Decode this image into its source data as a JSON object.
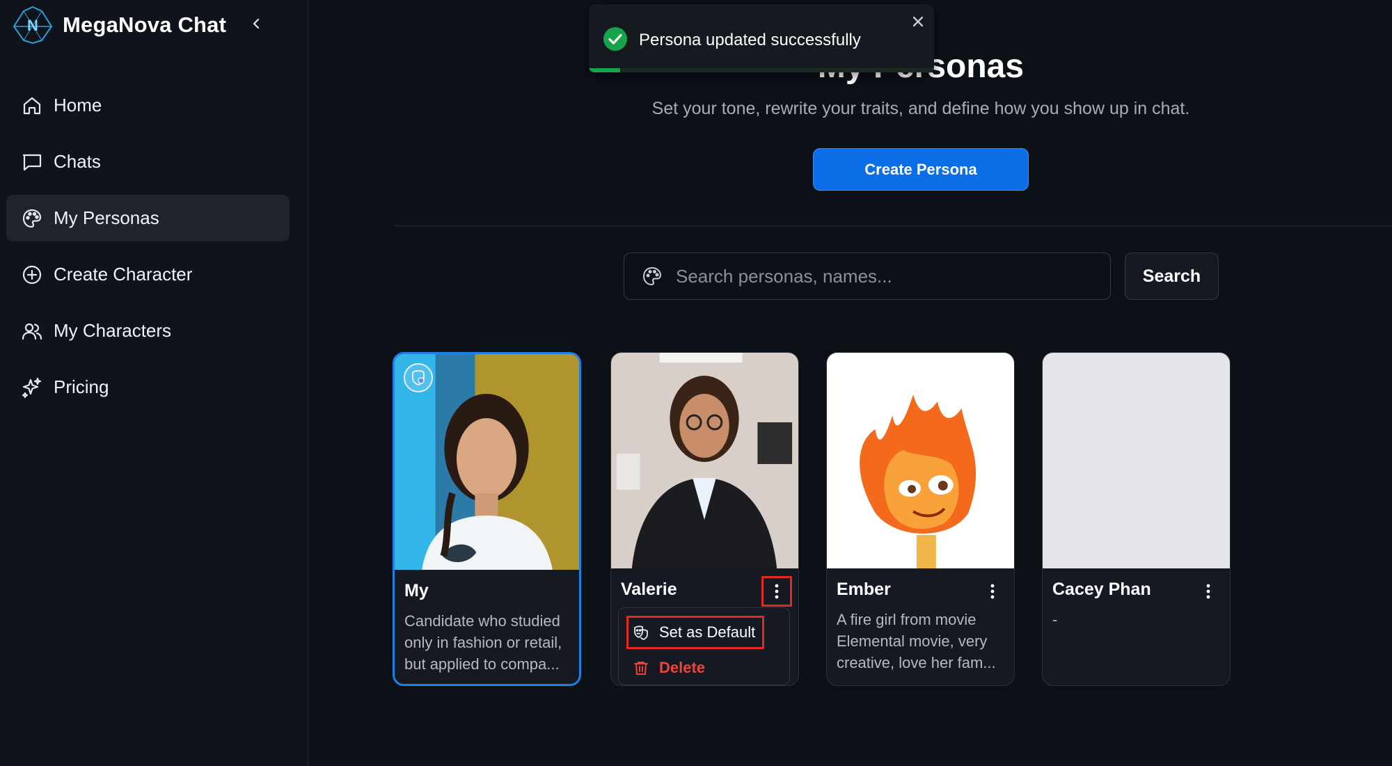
{
  "app": {
    "name": "MegaNova Chat"
  },
  "sidebar": {
    "items": [
      {
        "label": "Home",
        "icon": "home-icon"
      },
      {
        "label": "Chats",
        "icon": "chat-icon"
      },
      {
        "label": "My Personas",
        "icon": "palette-icon",
        "active": true
      },
      {
        "label": "Create Character",
        "icon": "plus-circle-icon"
      },
      {
        "label": "My Characters",
        "icon": "users-icon"
      },
      {
        "label": "Pricing",
        "icon": "sparkle-icon"
      }
    ]
  },
  "page": {
    "title": "My Personas",
    "subtitle": "Set your tone, rewrite your traits, and define how you show up in chat.",
    "create_button": "Create Persona"
  },
  "search": {
    "placeholder": "Search personas, names...",
    "value": "",
    "button": "Search"
  },
  "cards": [
    {
      "name": "My",
      "description": "Candidate who studied only in fashion or retail, but applied to compa...",
      "is_default": true
    },
    {
      "name": "Valerie",
      "description": "",
      "menu_open": true
    },
    {
      "name": "Ember",
      "description": "A fire girl from movie Elemental movie, very creative, love her fam..."
    },
    {
      "name": "Cacey Phan",
      "description": "-"
    }
  ],
  "dropdown": {
    "set_default": "Set as Default",
    "delete": "Delete"
  },
  "toast": {
    "message": "Persona updated successfully",
    "progress": 0.09
  },
  "colors": {
    "accent": "#0b6ee6",
    "success": "#16a34a",
    "danger": "#f0443a",
    "highlight": "#e02a1b"
  }
}
